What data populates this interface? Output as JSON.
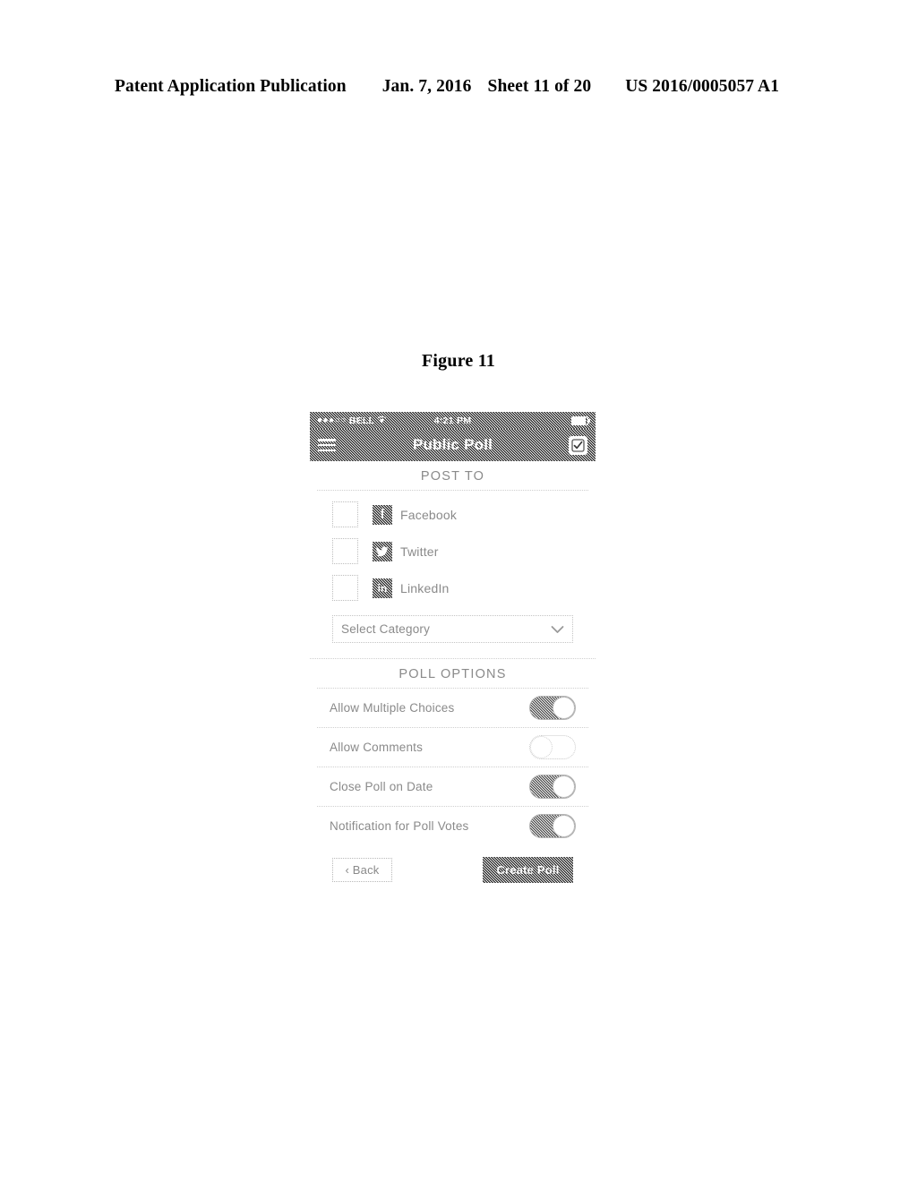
{
  "page_header": {
    "publication": "Patent Application Publication",
    "date": "Jan. 7, 2016",
    "sheet": "Sheet 11 of 20",
    "publication_number": "US 2016/0005057 A1"
  },
  "figure": {
    "caption": "Figure 11"
  },
  "mockup": {
    "status_bar": {
      "signal_dots": "●●●○○",
      "carrier": "BELL",
      "wifi_icon": "wifi-icon",
      "time": "4:21 PM",
      "battery_icon": "battery-icon"
    },
    "title_bar": {
      "menu_icon": "hamburger-menu-icon",
      "title": "Public Poll",
      "action_icon": "checkbox-check-icon"
    },
    "post_to": {
      "section_title": "POST TO",
      "items": [
        {
          "label": "Facebook",
          "icon": "facebook-icon",
          "glyph": "f",
          "checked": false
        },
        {
          "label": "Twitter",
          "icon": "twitter-icon",
          "glyph": "",
          "checked": false
        },
        {
          "label": "LinkedIn",
          "icon": "linkedin-icon",
          "glyph": "in",
          "checked": false
        }
      ],
      "category_select": {
        "value": "Select Category",
        "chevron_icon": "chevron-down-icon"
      }
    },
    "poll_options": {
      "section_title": "POLL OPTIONS",
      "items": [
        {
          "label": "Allow Multiple Choices",
          "state": "on"
        },
        {
          "label": "Allow Comments",
          "state": "off"
        },
        {
          "label": "Close Poll on Date",
          "state": "on"
        },
        {
          "label": "Notification for Poll Votes",
          "state": "on"
        }
      ]
    },
    "buttons": {
      "back": "‹ Back",
      "create": "Create Poll"
    }
  },
  "colors": {
    "line_art_gray": "#8a8a8a",
    "bar_dark": "#8c8c8c",
    "white": "#ffffff",
    "border_light": "#c4c4c4"
  }
}
